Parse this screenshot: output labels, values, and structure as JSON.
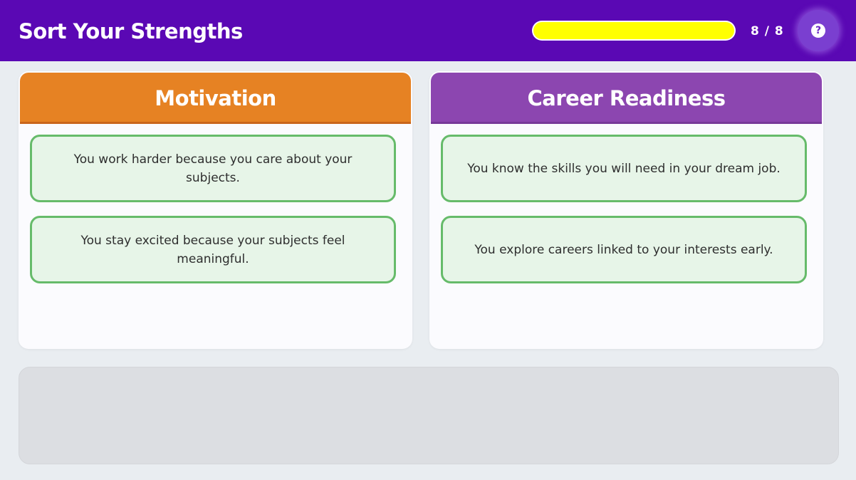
{
  "header": {
    "title": "Sort Your Strengths",
    "progress_fraction": 1.0,
    "progress_label": "8 / 8",
    "help_icon": "?",
    "colors": {
      "background": "#5a08b4",
      "progress_fill": "#ffff00"
    }
  },
  "categories": [
    {
      "title": "Motivation",
      "color": "#e68223",
      "cards": [
        "You work harder because you care about your subjects.",
        "You stay excited because your subjects feel meaningful."
      ]
    },
    {
      "title": "Career Readiness",
      "color": "#8c46b0",
      "cards": [
        "You know the skills you will need in your dream job.",
        "You explore careers linked to your interests early."
      ]
    }
  ],
  "card_style": {
    "background": "#e7f5e8",
    "border": "#66bb6a"
  },
  "drop_zone": {
    "cards": []
  }
}
